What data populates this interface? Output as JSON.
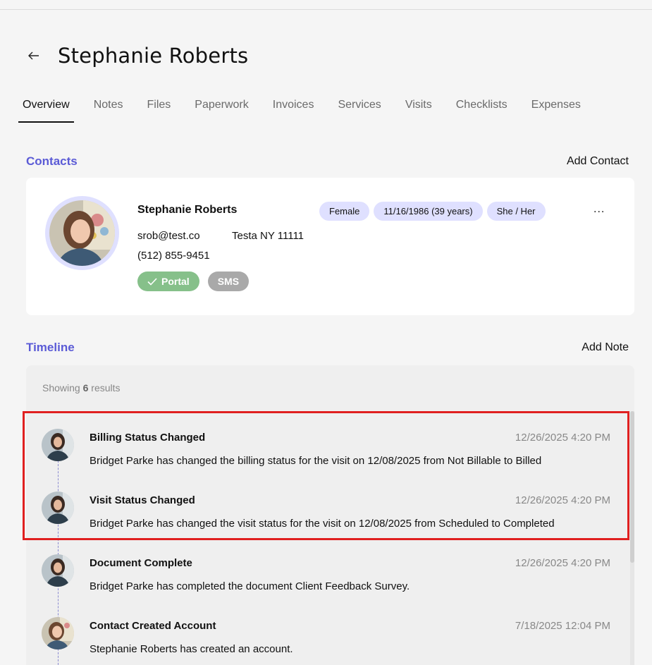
{
  "page": {
    "title": "Stephanie Roberts",
    "back_icon": "arrow-left-icon"
  },
  "tabs": [
    {
      "label": "Overview",
      "active": true
    },
    {
      "label": "Notes",
      "active": false
    },
    {
      "label": "Files",
      "active": false
    },
    {
      "label": "Paperwork",
      "active": false
    },
    {
      "label": "Invoices",
      "active": false
    },
    {
      "label": "Services",
      "active": false
    },
    {
      "label": "Visits",
      "active": false
    },
    {
      "label": "Checklists",
      "active": false
    },
    {
      "label": "Expenses",
      "active": false
    }
  ],
  "contacts": {
    "title": "Contacts",
    "action": "Add Contact",
    "card": {
      "name": "Stephanie Roberts",
      "email": "srob@test.co",
      "address": "Testa NY 11111",
      "phone": "(512) 855-9451",
      "chips": [
        "Female",
        "11/16/1986 (39 years)",
        "She / Her"
      ],
      "more": "...",
      "portal_label": "Portal",
      "sms_label": "SMS"
    }
  },
  "timeline": {
    "title": "Timeline",
    "action": "Add Note",
    "showing_prefix": "Showing ",
    "count": "6",
    "showing_suffix": " results",
    "entries": [
      {
        "title": "Billing Status Changed",
        "time": "12/26/2025 4:20 PM",
        "desc": "Bridget Parke has changed the billing status for the visit on 12/08/2025 from Not Billable to Billed"
      },
      {
        "title": "Visit Status Changed",
        "time": "12/26/2025 4:20 PM",
        "desc": "Bridget Parke has changed the visit status for the visit on 12/08/2025 from Scheduled to Completed"
      },
      {
        "title": "Document Complete",
        "time": "12/26/2025 4:20 PM",
        "desc": "Bridget Parke has completed the document Client Feedback Survey."
      },
      {
        "title": "Contact Created Account",
        "time": "7/18/2025 12:04 PM",
        "desc": "Stephanie Roberts has created an account."
      }
    ]
  },
  "colors": {
    "accent": "#5b5bd6",
    "chip_bg": "#dfe0ff",
    "portal": "#86c08a",
    "sms": "#a9a9a9",
    "highlight": "#e02020"
  }
}
